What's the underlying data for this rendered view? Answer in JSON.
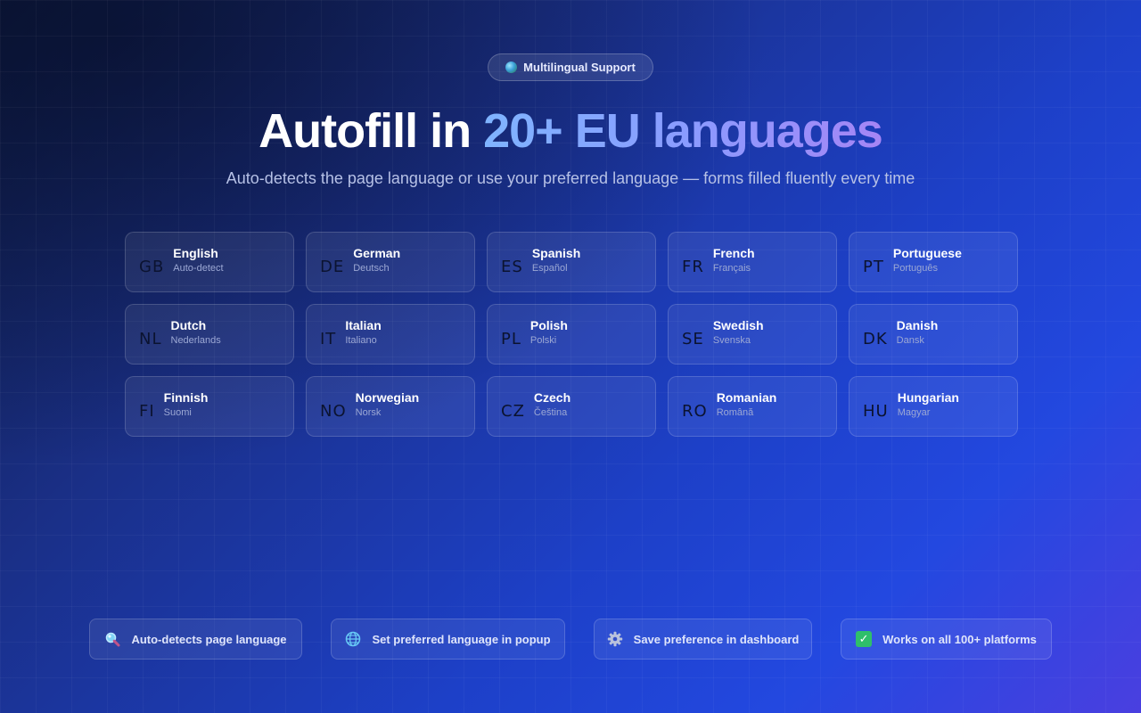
{
  "badge": {
    "icon": "globe-icon",
    "label": "Multilingual Support"
  },
  "headline": {
    "plain": "Autofill in ",
    "accent": "20+ EU languages"
  },
  "subtitle": "Auto-detects the page language or use your preferred language — forms filled fluently every time",
  "languages": [
    {
      "code": "GB",
      "name": "English",
      "native": "Auto-detect"
    },
    {
      "code": "DE",
      "name": "German",
      "native": "Deutsch"
    },
    {
      "code": "ES",
      "name": "Spanish",
      "native": "Español"
    },
    {
      "code": "FR",
      "name": "French",
      "native": "Français"
    },
    {
      "code": "PT",
      "name": "Portuguese",
      "native": "Português"
    },
    {
      "code": "NL",
      "name": "Dutch",
      "native": "Nederlands"
    },
    {
      "code": "IT",
      "name": "Italian",
      "native": "Italiano"
    },
    {
      "code": "PL",
      "name": "Polish",
      "native": "Polski"
    },
    {
      "code": "SE",
      "name": "Swedish",
      "native": "Svenska"
    },
    {
      "code": "DK",
      "name": "Danish",
      "native": "Dansk"
    },
    {
      "code": "FI",
      "name": "Finnish",
      "native": "Suomi"
    },
    {
      "code": "NO",
      "name": "Norwegian",
      "native": "Norsk"
    },
    {
      "code": "CZ",
      "name": "Czech",
      "native": "Čeština"
    },
    {
      "code": "RO",
      "name": "Romanian",
      "native": "Română"
    },
    {
      "code": "HU",
      "name": "Hungarian",
      "native": "Magyar"
    }
  ],
  "features": [
    {
      "icon": "magnifier-icon",
      "label": "Auto-detects page language"
    },
    {
      "icon": "globe-icon",
      "label": "Set preferred language in popup"
    },
    {
      "icon": "gear-icon",
      "label": "Save preference in dashboard"
    },
    {
      "icon": "checkmark-icon",
      "label": "Works on all 100+ platforms"
    }
  ],
  "colors": {
    "accent_start": "#7fb4ff",
    "accent_end": "#a585f5",
    "check_green": "#2fbf6a"
  }
}
